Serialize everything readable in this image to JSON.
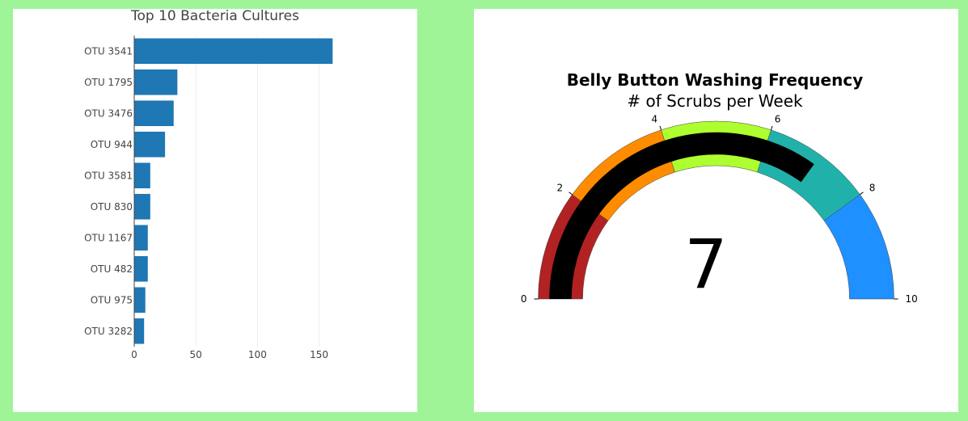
{
  "chart_data": [
    {
      "type": "bar",
      "orientation": "horizontal",
      "title": "Top 10 Bacteria Cultures",
      "categories": [
        "OTU 3541",
        "OTU 1795",
        "OTU 3476",
        "OTU 944",
        "OTU 3581",
        "OTU 830",
        "OTU 1167",
        "OTU 482",
        "OTU 975",
        "OTU 3282"
      ],
      "values": [
        161,
        35,
        32,
        25,
        13,
        13,
        11,
        11,
        9,
        8
      ],
      "xlim": [
        0,
        210
      ],
      "xticks": [
        0,
        50,
        100,
        150
      ],
      "grid": true,
      "bar_color": "#1f77b4"
    },
    {
      "type": "gauge",
      "title": "Belly Button Washing Frequency",
      "subtitle": "# of Scrubs per Week",
      "value": 7,
      "range": [
        0,
        10
      ],
      "ticks": [
        0,
        2,
        4,
        6,
        8,
        10
      ],
      "steps": [
        {
          "range": [
            0,
            2
          ],
          "color": "#b22222"
        },
        {
          "range": [
            2,
            4
          ],
          "color": "#ff8c00"
        },
        {
          "range": [
            4,
            6
          ],
          "color": "#adff2f"
        },
        {
          "range": [
            6,
            8
          ],
          "color": "#20b2aa"
        },
        {
          "range": [
            8,
            10
          ],
          "color": "#1e90ff"
        }
      ],
      "bar_color": "#000000"
    }
  ]
}
